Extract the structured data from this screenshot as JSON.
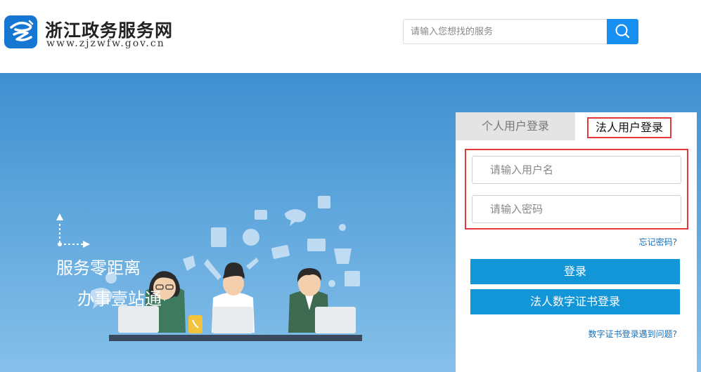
{
  "header": {
    "site_title": "浙江政务服务网",
    "site_url": "www.zjzwfw.gov.cn",
    "search_placeholder": "请输入您想找的服务"
  },
  "banner": {
    "slogan_line1": "服务零距离",
    "slogan_line2": "办事壹站通"
  },
  "login": {
    "tabs": [
      {
        "label": "个人用户登录",
        "active": false
      },
      {
        "label": "法人用户登录",
        "active": true
      }
    ],
    "username_placeholder": "请输入用户名",
    "password_placeholder": "请输入密码",
    "forgot_password": "忘记密码?",
    "login_button": "登录",
    "cert_login_button": "法人数字证书登录",
    "cert_help": "数字证书登录遇到问题?"
  },
  "colors": {
    "brand_blue": "#1677d2",
    "search_button": "#1890f2",
    "login_button": "#1296d8",
    "highlight_red": "#e23a3a"
  },
  "icons": [
    "zhejiang-logo-icon",
    "search-icon",
    "customer-service-illustration"
  ]
}
